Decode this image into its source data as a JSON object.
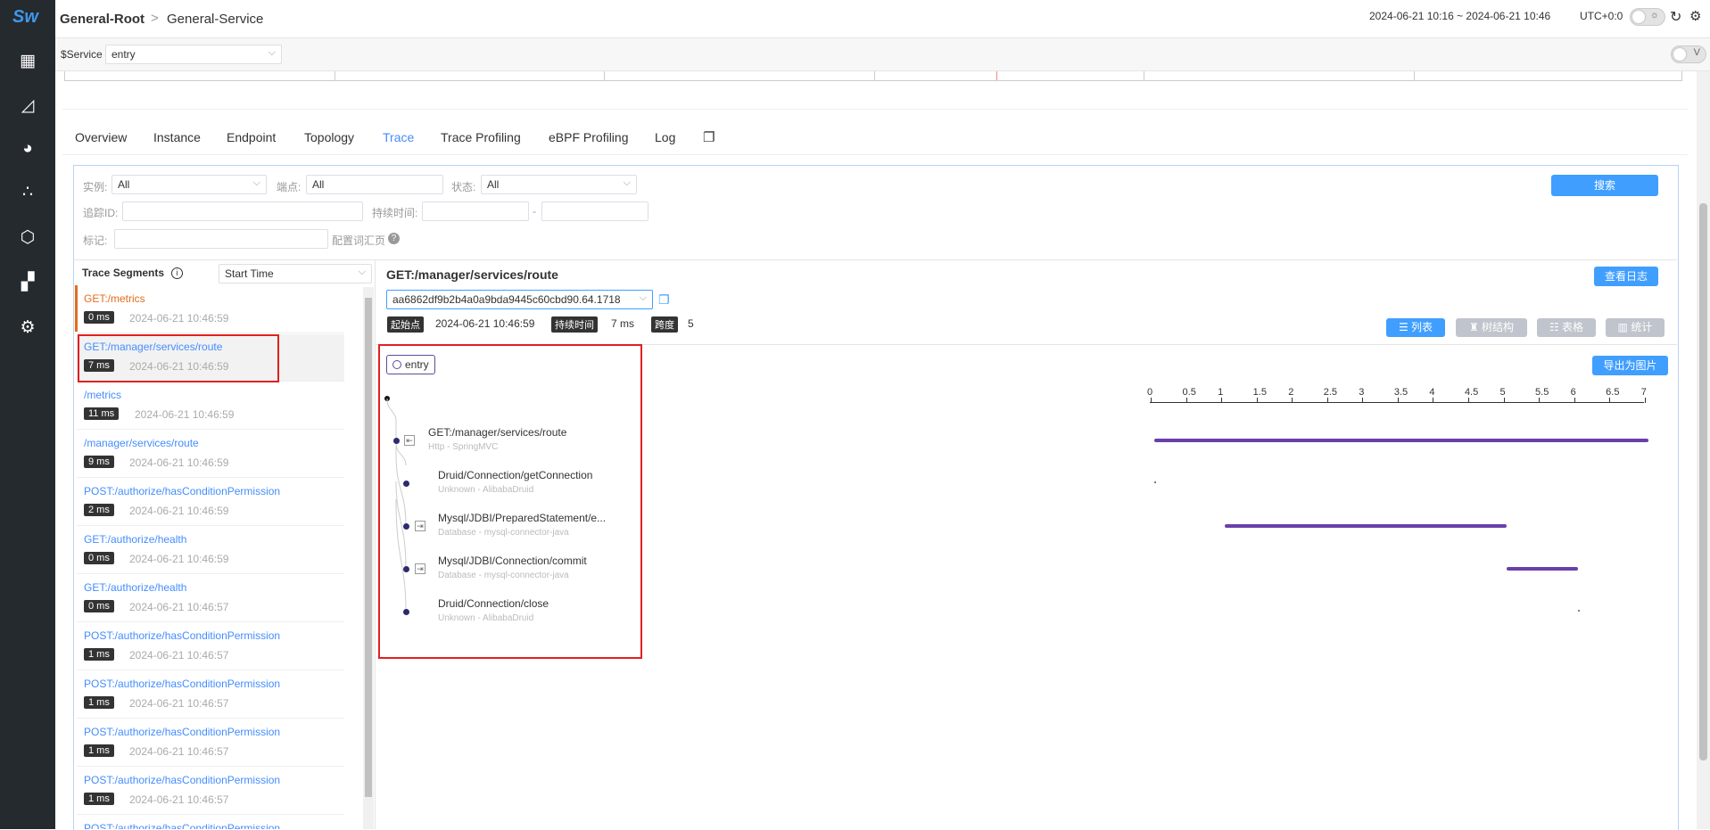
{
  "app": {
    "logo": "Sw"
  },
  "nav_icons": [
    "dashboard-icon",
    "chart-icon",
    "pie-chart-icon",
    "topology-icon",
    "alarm-icon",
    "widgets-icon",
    "settings-icon"
  ],
  "header": {
    "crumb_root": "General-Root",
    "crumb_sep": ">",
    "crumb_service": "General-Service",
    "time_range": "2024-06-21 10:16 ~ 2024-06-21 10:46",
    "timezone": "UTC+0:0",
    "toggle_label": "V"
  },
  "vars": {
    "service_label": "$Service",
    "service_value": "entry"
  },
  "tabs": [
    "Overview",
    "Instance",
    "Endpoint",
    "Topology",
    "Trace",
    "Trace Profiling",
    "eBPF Profiling",
    "Log"
  ],
  "filters": {
    "instance_label": "实例:",
    "instance_value": "All",
    "endpoint_label": "端点:",
    "endpoint_value": "All",
    "status_label": "状态:",
    "status_value": "All",
    "trace_id_label": "追踪ID:",
    "duration_label": "持续时间:",
    "duration_sep": "-",
    "tag_label": "标记:",
    "config_label": "配置词汇页",
    "help": "?",
    "search_button": "搜索"
  },
  "segments": {
    "title": "Trace Segments",
    "info": "i",
    "sort_value": "Start Time",
    "items": [
      {
        "endpoint": "GET:/metrics",
        "duration": "0 ms",
        "time": "2024-06-21 10:46:59"
      },
      {
        "endpoint": "GET:/manager/services/route",
        "duration": "7 ms",
        "time": "2024-06-21 10:46:59"
      },
      {
        "endpoint": "/metrics",
        "duration": "11 ms",
        "time": "2024-06-21 10:46:59"
      },
      {
        "endpoint": "/manager/services/route",
        "duration": "9 ms",
        "time": "2024-06-21 10:46:59"
      },
      {
        "endpoint": "POST:/authorize/hasConditionPermission",
        "duration": "2 ms",
        "time": "2024-06-21 10:46:59"
      },
      {
        "endpoint": "GET:/authorize/health",
        "duration": "0 ms",
        "time": "2024-06-21 10:46:59"
      },
      {
        "endpoint": "GET:/authorize/health",
        "duration": "0 ms",
        "time": "2024-06-21 10:46:57"
      },
      {
        "endpoint": "POST:/authorize/hasConditionPermission",
        "duration": "1 ms",
        "time": "2024-06-21 10:46:57"
      },
      {
        "endpoint": "POST:/authorize/hasConditionPermission",
        "duration": "1 ms",
        "time": "2024-06-21 10:46:57"
      },
      {
        "endpoint": "POST:/authorize/hasConditionPermission",
        "duration": "1 ms",
        "time": "2024-06-21 10:46:57"
      },
      {
        "endpoint": "POST:/authorize/hasConditionPermission",
        "duration": "1 ms",
        "time": "2024-06-21 10:46:57"
      },
      {
        "endpoint": "POST:/authorize/hasConditionPermission",
        "duration": "",
        "time": ""
      }
    ]
  },
  "detail": {
    "title": "GET:/manager/services/route",
    "view_logs": "查看日志",
    "trace_id": "aa6862df9b2b4a0a9bda9445c60cbd90.64.1718",
    "start_label": "起始点",
    "start_value": "2024-06-21 10:46:59",
    "duration_label": "持续时间",
    "duration_value": "7 ms",
    "span_label": "跨度",
    "span_value": "5",
    "views": [
      "列表",
      "树结构",
      "表格",
      "统计"
    ],
    "export": "导出为图片",
    "root_service": "entry"
  },
  "axis_ticks": [
    "0",
    "0.5",
    "1",
    "1.5",
    "2",
    "2.5",
    "3",
    "3.5",
    "4",
    "4.5",
    "5",
    "5.5",
    "6",
    "6.5",
    "7"
  ],
  "spans": [
    {
      "name": "GET:/manager/services/route",
      "sub": "Http - SpringMVC",
      "start": 0.05,
      "end": 7.05
    },
    {
      "name": "Druid/Connection/getConnection",
      "sub": "Unknown - AlibabaDruid",
      "start": 0.05,
      "end": 0.05
    },
    {
      "name": "Mysql/JDBI/PreparedStatement/e...",
      "sub": "Database - mysql-connector-java",
      "start": 1.05,
      "end": 5.05
    },
    {
      "name": "Mysql/JDBI/Connection/commit",
      "sub": "Database - mysql-connector-java",
      "start": 5.05,
      "end": 6.05
    },
    {
      "name": "Druid/Connection/close",
      "sub": "Unknown - AlibabaDruid",
      "start": 6.05,
      "end": 6.05
    }
  ],
  "colors": {
    "accent": "#409eff",
    "span_bar": "#6a3fa9",
    "highlight": "#e02020",
    "nav_bg": "#252a2f"
  }
}
